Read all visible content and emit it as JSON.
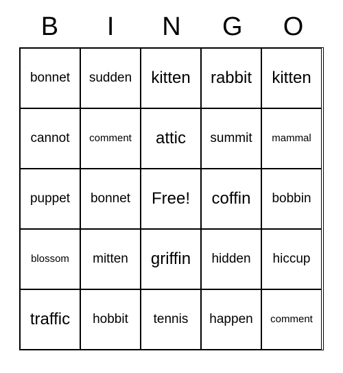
{
  "header": [
    "B",
    "I",
    "N",
    "G",
    "O"
  ],
  "grid": [
    [
      {
        "text": "bonnet",
        "size": "normal"
      },
      {
        "text": "sudden",
        "size": "normal"
      },
      {
        "text": "kitten",
        "size": "large"
      },
      {
        "text": "rabbit",
        "size": "large"
      },
      {
        "text": "kitten",
        "size": "large"
      }
    ],
    [
      {
        "text": "cannot",
        "size": "normal"
      },
      {
        "text": "comment",
        "size": "small"
      },
      {
        "text": "attic",
        "size": "large"
      },
      {
        "text": "summit",
        "size": "normal"
      },
      {
        "text": "mammal",
        "size": "small"
      }
    ],
    [
      {
        "text": "puppet",
        "size": "normal"
      },
      {
        "text": "bonnet",
        "size": "normal"
      },
      {
        "text": "Free!",
        "size": "large"
      },
      {
        "text": "coffin",
        "size": "large"
      },
      {
        "text": "bobbin",
        "size": "normal"
      }
    ],
    [
      {
        "text": "blossom",
        "size": "small"
      },
      {
        "text": "mitten",
        "size": "normal"
      },
      {
        "text": "griffin",
        "size": "large"
      },
      {
        "text": "hidden",
        "size": "normal"
      },
      {
        "text": "hiccup",
        "size": "normal"
      }
    ],
    [
      {
        "text": "traffic",
        "size": "large"
      },
      {
        "text": "hobbit",
        "size": "normal"
      },
      {
        "text": "tennis",
        "size": "normal"
      },
      {
        "text": "happen",
        "size": "normal"
      },
      {
        "text": "comment",
        "size": "small"
      }
    ]
  ]
}
